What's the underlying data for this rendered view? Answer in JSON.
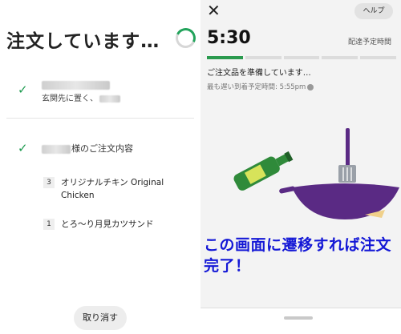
{
  "left": {
    "title": "注文しています…",
    "address": {
      "line2_suffix": "玄関先に置く、"
    },
    "order_heading_suffix": "様のご注文内容",
    "items": [
      {
        "qty": "3",
        "name": "オリジナルチキン Original Chicken"
      },
      {
        "qty": "1",
        "name": "とろ〜り月見カツサンド"
      }
    ],
    "cancel_label": "取り消す"
  },
  "right": {
    "help_label": "ヘルプ",
    "time": "5:30",
    "eta_label": "配達予定時間",
    "status_text": "ご注文品を準備しています…",
    "latest_arrival": "最も遅い到着予定時間: 5:55pm",
    "overlay_text": "この画面に遷移すれば注文完了！",
    "progress": {
      "steps": 5,
      "completed": 1
    }
  },
  "colors": {
    "accent_green": "#2a9a4e",
    "overlay_blue": "#1418d6",
    "wok_purple": "#5a2a84"
  },
  "icons": [
    "check-icon",
    "spinner-icon",
    "close-icon",
    "info-icon"
  ]
}
